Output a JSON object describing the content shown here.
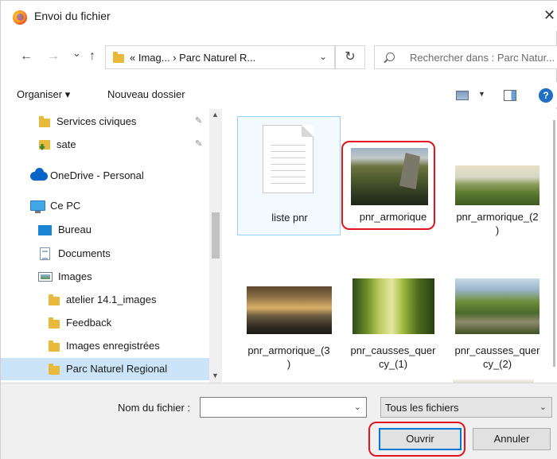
{
  "window": {
    "title": "Envoi du fichier",
    "close_glyph": "✕"
  },
  "navigation": {
    "back_glyph": "←",
    "forward_glyph": "→",
    "history_glyph": "⌄",
    "up_glyph": "↑",
    "breadcrumb": "« Imag... › Parc Naturel R...",
    "address_dropdown_glyph": "⌄",
    "refresh_glyph": "↻",
    "search_placeholder": "Rechercher dans : Parc Natur..."
  },
  "toolbar": {
    "organize_label": "Organiser ▾",
    "new_folder_label": "Nouveau dossier",
    "help_label": "?"
  },
  "sidebar": {
    "items": [
      {
        "label": "Services civiques",
        "icon": "folder-icon",
        "pinned": true
      },
      {
        "label": "sate",
        "icon": "download-folder-icon",
        "pinned": true
      },
      {
        "label": "OneDrive - Personal",
        "icon": "cloud-icon"
      },
      {
        "label": "Ce PC",
        "icon": "computer-icon"
      },
      {
        "label": "Bureau",
        "icon": "desktop-icon"
      },
      {
        "label": "Documents",
        "icon": "documents-icon"
      },
      {
        "label": "Images",
        "icon": "pictures-icon"
      },
      {
        "label": "atelier 14.1_images",
        "icon": "folder-icon"
      },
      {
        "label": "Feedback",
        "icon": "folder-icon"
      },
      {
        "label": "Images enregistrées",
        "icon": "folder-icon"
      },
      {
        "label": "Parc Naturel Regional",
        "icon": "folder-icon",
        "selected": true
      }
    ],
    "pin_glyph": "📌"
  },
  "files": [
    {
      "name": "liste pnr",
      "kind": "text-document"
    },
    {
      "name": "pnr_armorique",
      "kind": "image",
      "highlighted": true
    },
    {
      "name_line1": "pnr_armorique_(2",
      "name_line2": ")",
      "kind": "image"
    },
    {
      "name_line1": "pnr_armorique_(3",
      "name_line2": ")",
      "kind": "image"
    },
    {
      "name_line1": "pnr_causses_quer",
      "name_line2": "cy_(1)",
      "kind": "image"
    },
    {
      "name_line1": "pnr_causses_quer",
      "name_line2": "cy_(2)",
      "kind": "image"
    }
  ],
  "footer": {
    "filename_label": "Nom du fichier :",
    "filename_value": "",
    "filename_dropdown_glyph": "⌄",
    "filetype_value": "Tous les fichiers",
    "filetype_caret": "⌄",
    "open_label": "Ouvrir",
    "cancel_label": "Annuler"
  },
  "colors": {
    "selection": "#cce4f7",
    "accent": "#0078d7",
    "annotation_red": "#e0141e"
  }
}
